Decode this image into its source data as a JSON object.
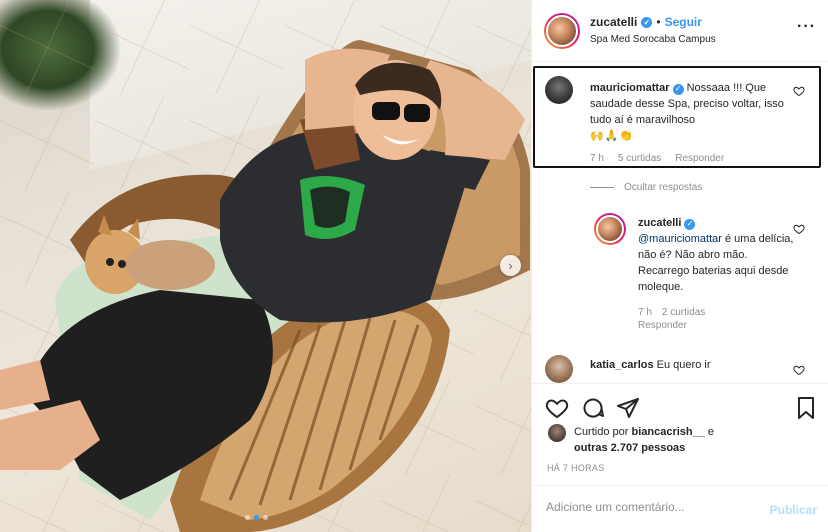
{
  "post": {
    "author": "zucatelli",
    "follow_label": "Seguir",
    "separator": "•",
    "location": "Spa Med Sorocaba Campus",
    "more_label": "···"
  },
  "comments": [
    {
      "username": "mauriciomattar",
      "text": "Nossaaa !!! Que saudade desse Spa, preciso voltar, isso tudo aí é maravilhoso",
      "emoji": "🙌🙏👏",
      "time": "7 h",
      "likes": "5 curtidas",
      "reply_label": "Responder"
    },
    {
      "username": "zucatelli",
      "mention": "@mauriciomattar",
      "text": "é uma delícia, não é? Não abro mão. Recarrego baterias aqui desde moleque.",
      "time": "7 h",
      "likes": "2 curtidas",
      "reply_label": "Responder"
    },
    {
      "username": "katia_carlos",
      "text": "Eu quero ir"
    }
  ],
  "hide_replies_label": "Ocultar respostas",
  "likes": {
    "prefix": "Curtido por",
    "user": "biancacrish__",
    "conjunction": "e",
    "others": "outras 2.707 pessoas"
  },
  "timestamp": "HÁ 7 HORAS",
  "add_comment": {
    "placeholder": "Adicione um comentário...",
    "publish_label": "Publicar"
  },
  "carousel": {
    "next_icon": "›",
    "slide": 2,
    "slide_count": 3
  },
  "colors": {
    "accent": "#3897f0",
    "link": "#00376b",
    "muted": "#8e8e8e",
    "publish_disabled": "#b2dffc"
  }
}
